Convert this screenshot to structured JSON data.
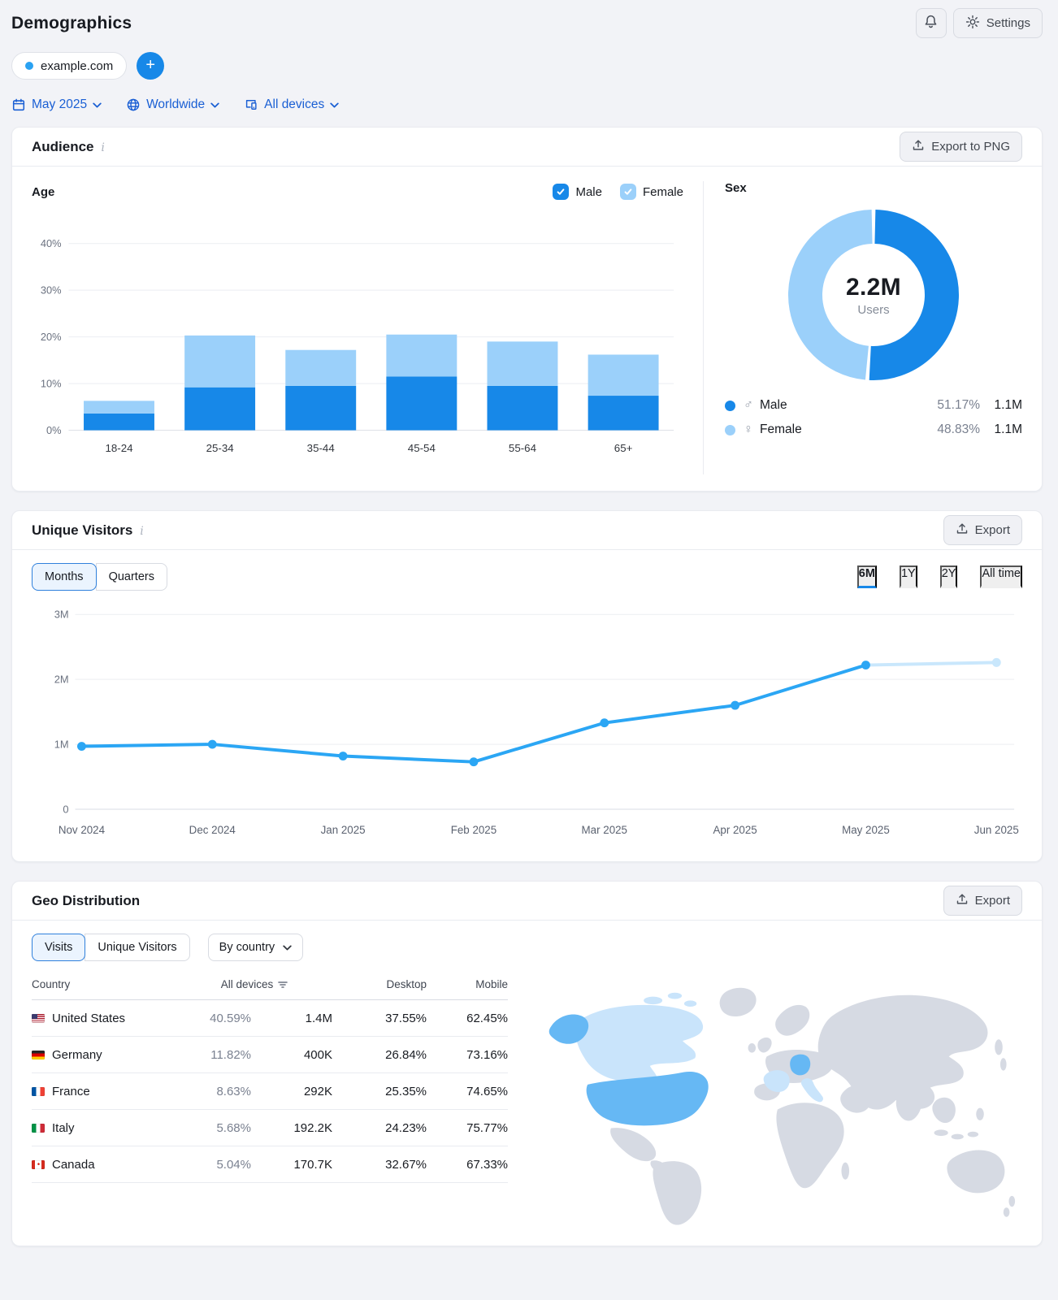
{
  "header": {
    "title": "Demographics",
    "settings_label": "Settings"
  },
  "project": {
    "domain": "example.com",
    "add_label": "+"
  },
  "filters": {
    "date": "May 2025",
    "region": "Worldwide",
    "devices": "All devices"
  },
  "ui": {
    "info_glyph": "i"
  },
  "audience": {
    "title": "Audience",
    "export_label": "Export to PNG",
    "age_title": "Age",
    "legend": {
      "male": "Male",
      "female": "Female"
    },
    "sex_title": "Sex",
    "donut_center_value": "2.2M",
    "donut_center_label": "Users",
    "sex_legend": [
      {
        "symbol": "♂",
        "label": "Male",
        "pct": "51.17%",
        "value": "1.1M",
        "color": "#1788e8"
      },
      {
        "symbol": "♀",
        "label": "Female",
        "pct": "48.83%",
        "value": "1.1M",
        "color": "#9bd0fa"
      }
    ]
  },
  "unique_visitors": {
    "title": "Unique Visitors",
    "export_label": "Export",
    "granularity": [
      {
        "label": "Months",
        "active": true
      },
      {
        "label": "Quarters",
        "active": false
      }
    ],
    "ranges": [
      {
        "label": "6M",
        "active": true
      },
      {
        "label": "1Y",
        "active": false
      },
      {
        "label": "2Y",
        "active": false
      },
      {
        "label": "All time",
        "active": false
      }
    ]
  },
  "geo": {
    "title": "Geo Distribution",
    "export_label": "Export",
    "metric_toggle": [
      {
        "label": "Visits",
        "active": true
      },
      {
        "label": "Unique Visitors",
        "active": false
      }
    ],
    "group_by_label": "By country",
    "table": {
      "headers": {
        "country": "Country",
        "all_devices": "All devices",
        "desktop": "Desktop",
        "mobile": "Mobile"
      },
      "rows": [
        {
          "flag": "us",
          "country": "United States",
          "share": "40.59%",
          "visits": "1.4M",
          "desktop": "37.55%",
          "mobile": "62.45%"
        },
        {
          "flag": "de",
          "country": "Germany",
          "share": "11.82%",
          "visits": "400K",
          "desktop": "26.84%",
          "mobile": "73.16%"
        },
        {
          "flag": "fr",
          "country": "France",
          "share": "8.63%",
          "visits": "292K",
          "desktop": "25.35%",
          "mobile": "74.65%"
        },
        {
          "flag": "it",
          "country": "Italy",
          "share": "5.68%",
          "visits": "192.2K",
          "desktop": "24.23%",
          "mobile": "75.77%"
        },
        {
          "flag": "ca",
          "country": "Canada",
          "share": "5.04%",
          "visits": "170.7K",
          "desktop": "32.67%",
          "mobile": "67.33%"
        }
      ]
    },
    "map_highlights": {
      "strong": [
        "United States",
        "Germany"
      ],
      "soft": [
        "Canada",
        "France",
        "Italy"
      ]
    }
  },
  "colors": {
    "accent_blue": "#1788e8",
    "male": "#1788e8",
    "female": "#9bd0fa",
    "line": "#2ba6f4",
    "line_proj": "#c9e7fc",
    "link": "#1a5fd4",
    "map_land": "#d6dae3",
    "map_strong": "#66b8f4",
    "map_soft": "#c9e4fb"
  },
  "chart_data": [
    {
      "id": "age_distribution",
      "type": "bar",
      "stacked": true,
      "title": "Age",
      "categories": [
        "18-24",
        "25-34",
        "35-44",
        "45-54",
        "55-64",
        "65+"
      ],
      "series": [
        {
          "name": "Male",
          "color": "#1788e8",
          "values": [
            3.6,
            9.2,
            9.5,
            11.5,
            9.5,
            7.4
          ]
        },
        {
          "name": "Female",
          "color": "#9bd0fa",
          "values": [
            2.7,
            11.1,
            7.7,
            9.0,
            9.5,
            8.8
          ]
        }
      ],
      "yticks": [
        0,
        10,
        20,
        30,
        40
      ],
      "ytick_labels": [
        "0%",
        "10%",
        "20%",
        "30%",
        "40%"
      ],
      "ylim": [
        0,
        44
      ],
      "grid": true,
      "legend_position": "top-right"
    },
    {
      "id": "sex_split",
      "type": "pie",
      "title": "Sex",
      "center_value": "2.2M",
      "center_label": "Users",
      "slices": [
        {
          "name": "Male",
          "pct": 51.17,
          "value": "1.1M",
          "color": "#1788e8"
        },
        {
          "name": "Female",
          "pct": 48.83,
          "value": "1.1M",
          "color": "#9bd0fa"
        }
      ]
    },
    {
      "id": "unique_visitors_trend",
      "type": "line",
      "title": "Unique Visitors",
      "x": [
        "Nov 2024",
        "Dec 2024",
        "Jan 2025",
        "Feb 2025",
        "Mar 2025",
        "Apr 2025",
        "May 2025",
        "Jun 2025"
      ],
      "values_millions": [
        0.97,
        1.0,
        0.82,
        0.73,
        1.33,
        1.6,
        2.22,
        2.26
      ],
      "projected_from_index": 6,
      "yticks_millions": [
        0,
        1,
        2,
        3
      ],
      "ytick_labels": [
        "0",
        "1M",
        "2M",
        "3M"
      ],
      "ylim_millions": [
        0,
        3
      ],
      "grid": true
    }
  ]
}
